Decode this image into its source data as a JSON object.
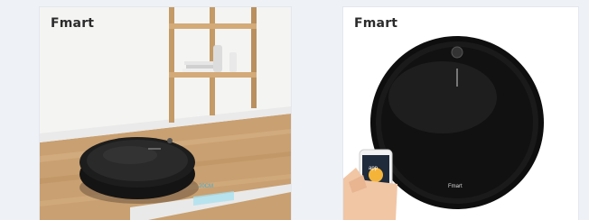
{
  "products": [
    {
      "brand": "Fmart",
      "floor_mark": "20CM",
      "robot_label": ""
    },
    {
      "brand": "Fmart",
      "robot_label": "Fmart",
      "phone_app": "app"
    }
  ]
}
